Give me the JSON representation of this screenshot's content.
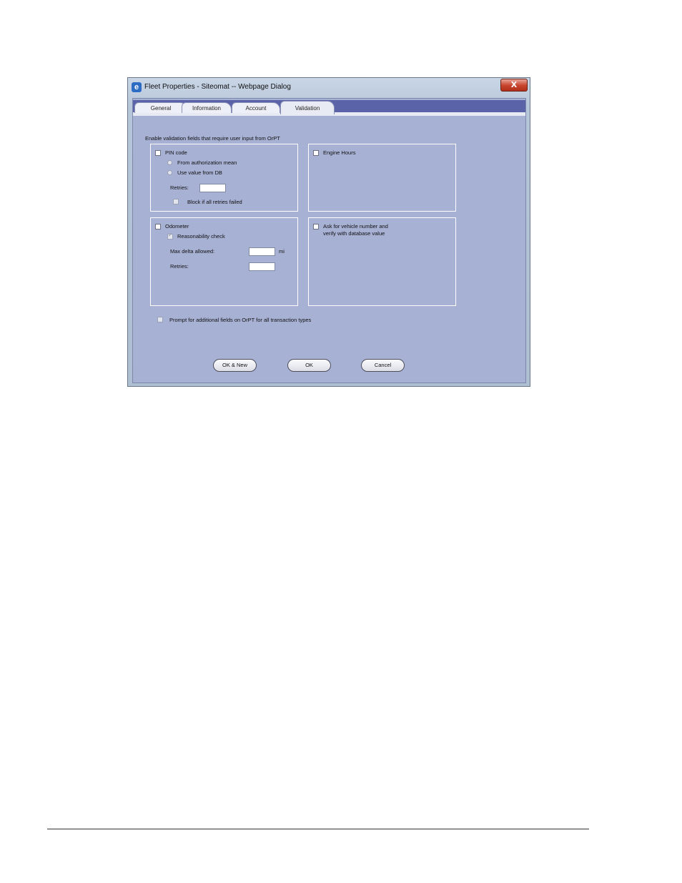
{
  "window": {
    "title": "Fleet Properties - Siteomat -- Webpage Dialog",
    "close_glyph": "X"
  },
  "tabs": [
    {
      "label": "General",
      "active": false
    },
    {
      "label": "Information",
      "active": false
    },
    {
      "label": "Account",
      "active": false
    },
    {
      "label": "Validation",
      "active": true
    }
  ],
  "validation": {
    "intro": "Enable validation fields that require user input from OrPT",
    "pin": {
      "label": "PIN code",
      "checked": false,
      "radio_from_auth": "From authorization mean",
      "radio_from_db": "Use value from DB",
      "retries_label": "Retries:",
      "retries_value": "",
      "block_label": "Block if all retries failed"
    },
    "engine_hours": {
      "label": "Engine Hours",
      "checked": false
    },
    "odometer": {
      "label": "Odometer",
      "checked": false,
      "reasonability_label": "Reasonability check",
      "max_delta_label": "Max delta allowed:",
      "max_delta_value": "",
      "unit": "mi",
      "retries_label": "Retries:",
      "retries_value": ""
    },
    "vehicle": {
      "label_line1": "Ask for vehicle number and",
      "label_line2": "verify with database value",
      "checked": false
    },
    "prompt_additional": {
      "label": "Prompt for additional fields on OrPT for all transaction types",
      "checked": false
    }
  },
  "buttons": {
    "ok_new": "OK & New",
    "ok": "OK",
    "cancel": "Cancel"
  }
}
